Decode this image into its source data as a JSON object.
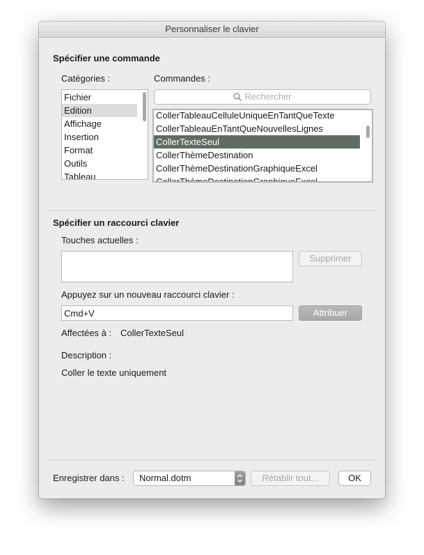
{
  "window": {
    "title": "Personnaliser le clavier"
  },
  "command_section": {
    "heading": "Spécifier une commande",
    "categories_label": "Catégories :",
    "commands_label": "Commandes :",
    "categories": [
      "Fichier",
      "Edition",
      "Affichage",
      "Insertion",
      "Format",
      "Outils",
      "Tableau"
    ],
    "selected_category": "Edition",
    "search_placeholder": "Rechercher",
    "commands": [
      "CollerTableauCelluleUniqueEnTantQueTexte",
      "CollerTableauEnTantQueNouvellesLignes",
      "CollerTexteSeul",
      "CollerThèmeDestination",
      "CollerThèmeDestinationGraphiqueExcel",
      "CollerThèmeDestinationGraphiqueExcel..."
    ],
    "selected_command": "CollerTexteSeul"
  },
  "shortcut_section": {
    "heading": "Spécifier un raccourci clavier",
    "current_keys_label": "Touches actuelles :",
    "current_keys": "",
    "remove_button": "Supprimer",
    "new_shortcut_label": "Appuyez sur un nouveau raccourci clavier :",
    "new_shortcut_value": "Cmd+V",
    "assign_button": "Attribuer",
    "assigned_to_label": "Affectées à :",
    "assigned_to_value": "CollerTexteSeul",
    "description_label": "Description :",
    "description_text": "Coller le texte uniquement"
  },
  "footer": {
    "save_in_label": "Enregistrer dans :",
    "save_in_value": "Normal.dotm",
    "reset_button": "Rétablir tout...",
    "ok_button": "OK"
  },
  "icons": {
    "search": "magnifier-icon",
    "stepper": "up-down-chevron-icon"
  },
  "colors": {
    "selected_command_bg": "#5f6b63",
    "selected_category_bg": "#dcdcdc",
    "assign_button_bg": "#afafaf"
  }
}
